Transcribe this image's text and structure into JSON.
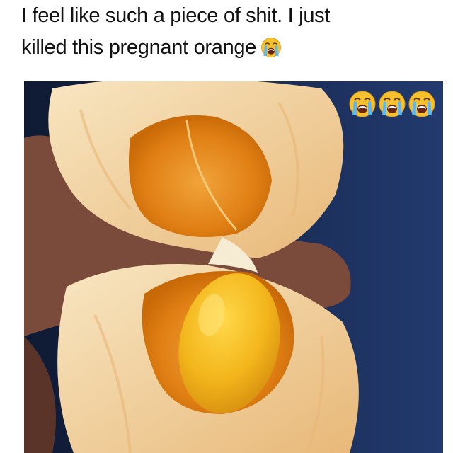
{
  "caption": {
    "line1": "I feel like such a piece of shit. I just",
    "line2": "killed this pregnant orange"
  },
  "emoji": {
    "inline": "loudly-crying-face-icon",
    "overlay": [
      "loudly-crying-face-icon",
      "loudly-crying-face-icon",
      "loudly-crying-face-icon"
    ]
  },
  "colors": {
    "background": "#ffffff",
    "text": "#111111",
    "backdrop": "#1c2b52",
    "peel": "#f4d9a8",
    "flesh": "#e58a1e",
    "baby_orange": "#f3b61c"
  }
}
